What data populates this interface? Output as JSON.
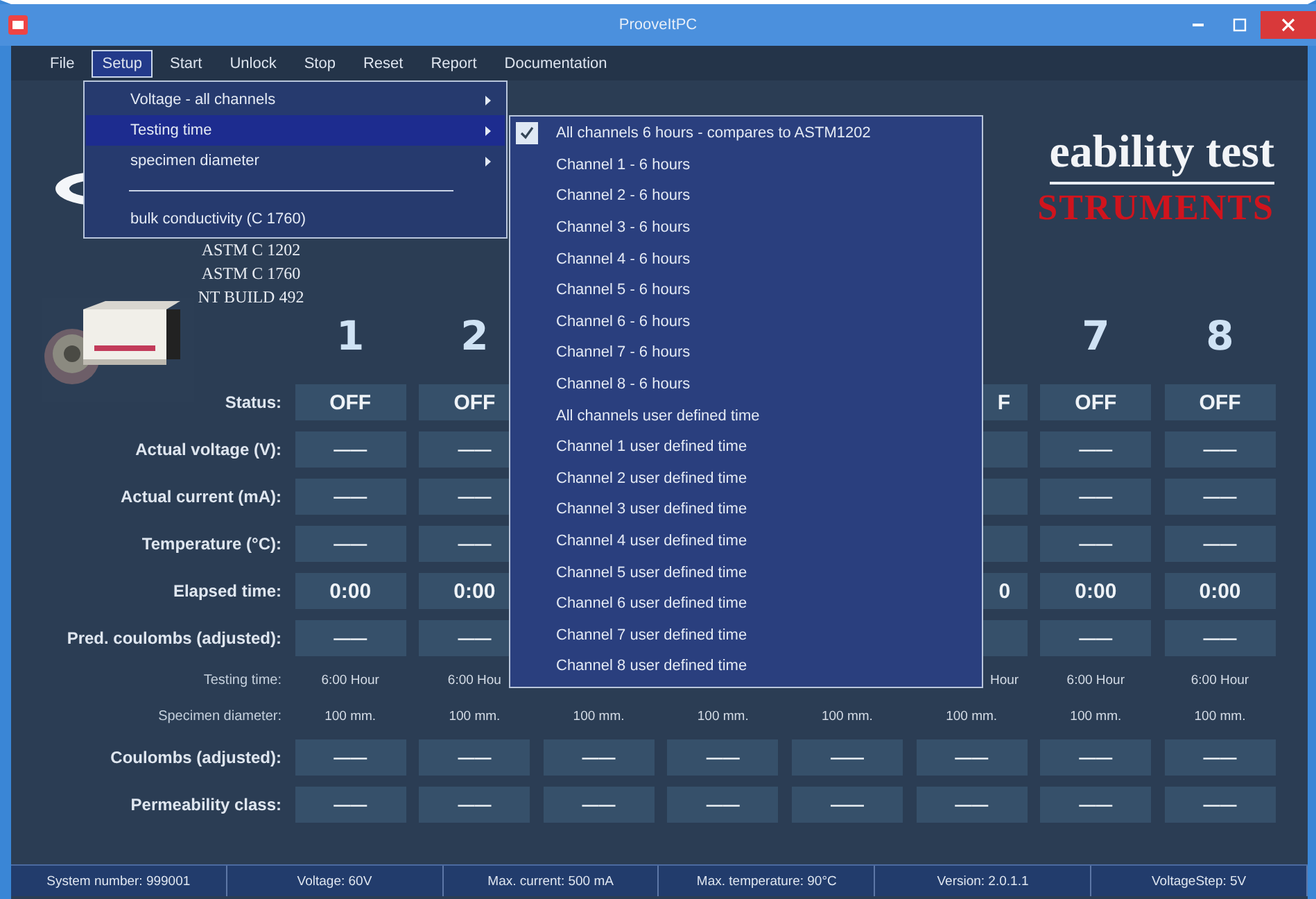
{
  "window": {
    "title": "ProoveItPC"
  },
  "menu_bar": [
    {
      "label": "File",
      "selected": false
    },
    {
      "label": "Setup",
      "selected": true
    },
    {
      "label": "Start",
      "selected": false
    },
    {
      "label": "Unlock",
      "selected": false
    },
    {
      "label": "Stop",
      "selected": false
    },
    {
      "label": "Reset",
      "selected": false
    },
    {
      "label": "Report",
      "selected": false
    },
    {
      "label": "Documentation",
      "selected": false
    }
  ],
  "setup_menu": {
    "items": [
      {
        "kind": "item",
        "label": "Voltage - all channels",
        "submenu": true,
        "selected": false
      },
      {
        "kind": "item",
        "label": "Testing time",
        "submenu": true,
        "selected": true
      },
      {
        "kind": "item",
        "label": "specimen diameter",
        "submenu": true,
        "selected": false
      },
      {
        "kind": "separator"
      },
      {
        "kind": "item",
        "label": "bulk conductivity (C 1760)",
        "submenu": false,
        "selected": false
      }
    ]
  },
  "testing_time_menu": {
    "items": [
      {
        "label": "All channels 6 hours - compares to ASTM1202",
        "checked": true
      },
      {
        "label": "Channel 1 - 6 hours",
        "checked": false
      },
      {
        "label": "Channel 2 - 6 hours",
        "checked": false
      },
      {
        "label": "Channel 3 - 6 hours",
        "checked": false
      },
      {
        "label": "Channel 4 - 6 hours",
        "checked": false
      },
      {
        "label": "Channel 5 - 6 hours",
        "checked": false
      },
      {
        "label": "Channel 6 - 6 hours",
        "checked": false
      },
      {
        "label": "Channel 7 - 6 hours",
        "checked": false
      },
      {
        "label": "Channel 8 - 6 hours",
        "checked": false
      },
      {
        "label": "All channels user defined time",
        "checked": false
      },
      {
        "label": "Channel 1 user defined time",
        "checked": false
      },
      {
        "label": "Channel 2 user defined time",
        "checked": false
      },
      {
        "label": "Channel 3 user defined time",
        "checked": false
      },
      {
        "label": "Channel 4 user defined time",
        "checked": false
      },
      {
        "label": "Channel 5 user defined time",
        "checked": false
      },
      {
        "label": "Channel 6 user defined time",
        "checked": false
      },
      {
        "label": "Channel 7 user defined time",
        "checked": false
      },
      {
        "label": "Channel 8 user defined time",
        "checked": false
      }
    ]
  },
  "header": {
    "title": "eability test",
    "brand": "STRUMENTS",
    "standards": [
      "ASTM C 1202",
      "ASTM C 1760",
      "NT BUILD 492"
    ]
  },
  "channels": {
    "headers": [
      {
        "kind": "number",
        "label": "1"
      },
      {
        "kind": "number",
        "label": "2"
      },
      {
        "kind": "covered"
      },
      {
        "kind": "covered"
      },
      {
        "kind": "covered"
      },
      {
        "kind": "covered"
      },
      {
        "kind": "number",
        "label": "7"
      },
      {
        "kind": "number",
        "label": "8"
      }
    ],
    "rows": [
      {
        "label": "Status:",
        "kind": "box",
        "cells": [
          {
            "kind": "value",
            "text": "OFF"
          },
          {
            "kind": "value",
            "text": "OFF"
          },
          {
            "kind": "covered"
          },
          {
            "kind": "covered"
          },
          {
            "kind": "covered"
          },
          {
            "kind": "value",
            "text": "F",
            "cut": true
          },
          {
            "kind": "value",
            "text": "OFF"
          },
          {
            "kind": "value",
            "text": "OFF"
          }
        ]
      },
      {
        "label": "Actual voltage (V):",
        "kind": "box",
        "cells": [
          {
            "kind": "value",
            "text": "——"
          },
          {
            "kind": "value",
            "text": "——"
          },
          {
            "kind": "covered"
          },
          {
            "kind": "covered"
          },
          {
            "kind": "covered"
          },
          {
            "kind": "empty"
          },
          {
            "kind": "value",
            "text": "——"
          },
          {
            "kind": "value",
            "text": "——"
          }
        ]
      },
      {
        "label": "Actual current (mA):",
        "kind": "box",
        "cells": [
          {
            "kind": "value",
            "text": "——"
          },
          {
            "kind": "value",
            "text": "——"
          },
          {
            "kind": "covered"
          },
          {
            "kind": "covered"
          },
          {
            "kind": "covered"
          },
          {
            "kind": "empty"
          },
          {
            "kind": "value",
            "text": "——"
          },
          {
            "kind": "value",
            "text": "——"
          }
        ]
      },
      {
        "label": "Temperature (°C):",
        "kind": "box",
        "cells": [
          {
            "kind": "value",
            "text": "——"
          },
          {
            "kind": "value",
            "text": "——"
          },
          {
            "kind": "covered"
          },
          {
            "kind": "covered"
          },
          {
            "kind": "covered"
          },
          {
            "kind": "empty"
          },
          {
            "kind": "value",
            "text": "——"
          },
          {
            "kind": "value",
            "text": "——"
          }
        ]
      },
      {
        "label": "Elapsed time:",
        "kind": "box",
        "cells": [
          {
            "kind": "value",
            "text": "0:00"
          },
          {
            "kind": "value",
            "text": "0:00"
          },
          {
            "kind": "covered"
          },
          {
            "kind": "covered"
          },
          {
            "kind": "covered"
          },
          {
            "kind": "value",
            "text": "0",
            "cut": true
          },
          {
            "kind": "value",
            "text": "0:00"
          },
          {
            "kind": "value",
            "text": "0:00"
          }
        ]
      },
      {
        "label": "Pred. coulombs (adjusted):",
        "kind": "box",
        "cells": [
          {
            "kind": "value",
            "text": "——"
          },
          {
            "kind": "value",
            "text": "——"
          },
          {
            "kind": "covered"
          },
          {
            "kind": "covered"
          },
          {
            "kind": "covered"
          },
          {
            "kind": "empty"
          },
          {
            "kind": "value",
            "text": "——"
          },
          {
            "kind": "value",
            "text": "——"
          }
        ]
      },
      {
        "label": "Testing time:",
        "kind": "plain",
        "cells": [
          {
            "kind": "value",
            "text": "6:00 Hour"
          },
          {
            "kind": "value",
            "text": "6:00 Hou"
          },
          {
            "kind": "covered"
          },
          {
            "kind": "covered"
          },
          {
            "kind": "covered"
          },
          {
            "kind": "value",
            "text": "Hour",
            "cut": true
          },
          {
            "kind": "value",
            "text": "6:00 Hour"
          },
          {
            "kind": "value",
            "text": "6:00 Hour"
          }
        ]
      },
      {
        "label": "Specimen diameter:",
        "kind": "plain",
        "cells": [
          {
            "kind": "value",
            "text": "100 mm."
          },
          {
            "kind": "value",
            "text": "100 mm."
          },
          {
            "kind": "value",
            "text": "100 mm."
          },
          {
            "kind": "value",
            "text": "100 mm."
          },
          {
            "kind": "value",
            "text": "100 mm."
          },
          {
            "kind": "value",
            "text": "100 mm."
          },
          {
            "kind": "value",
            "text": "100 mm."
          },
          {
            "kind": "value",
            "text": "100 mm."
          }
        ]
      },
      {
        "label": "Coulombs (adjusted):",
        "kind": "box",
        "cells": [
          {
            "kind": "value",
            "text": "——"
          },
          {
            "kind": "value",
            "text": "——"
          },
          {
            "kind": "value",
            "text": "——"
          },
          {
            "kind": "value",
            "text": "——"
          },
          {
            "kind": "value",
            "text": "——"
          },
          {
            "kind": "value",
            "text": "——"
          },
          {
            "kind": "value",
            "text": "——"
          },
          {
            "kind": "value",
            "text": "——"
          }
        ]
      },
      {
        "label": "Permeability class:",
        "kind": "box",
        "cells": [
          {
            "kind": "value",
            "text": "——"
          },
          {
            "kind": "value",
            "text": "——"
          },
          {
            "kind": "value",
            "text": "——"
          },
          {
            "kind": "value",
            "text": "——"
          },
          {
            "kind": "value",
            "text": "——"
          },
          {
            "kind": "value",
            "text": "——"
          },
          {
            "kind": "value",
            "text": "——"
          },
          {
            "kind": "value",
            "text": "——"
          }
        ]
      }
    ]
  },
  "status_bar": [
    "System number: 999001",
    "Voltage: 60V",
    "Max. current: 500 mA",
    "Max. temperature: 90°C",
    "Version: 2.0.1.1",
    "VoltageStep: 5V"
  ]
}
